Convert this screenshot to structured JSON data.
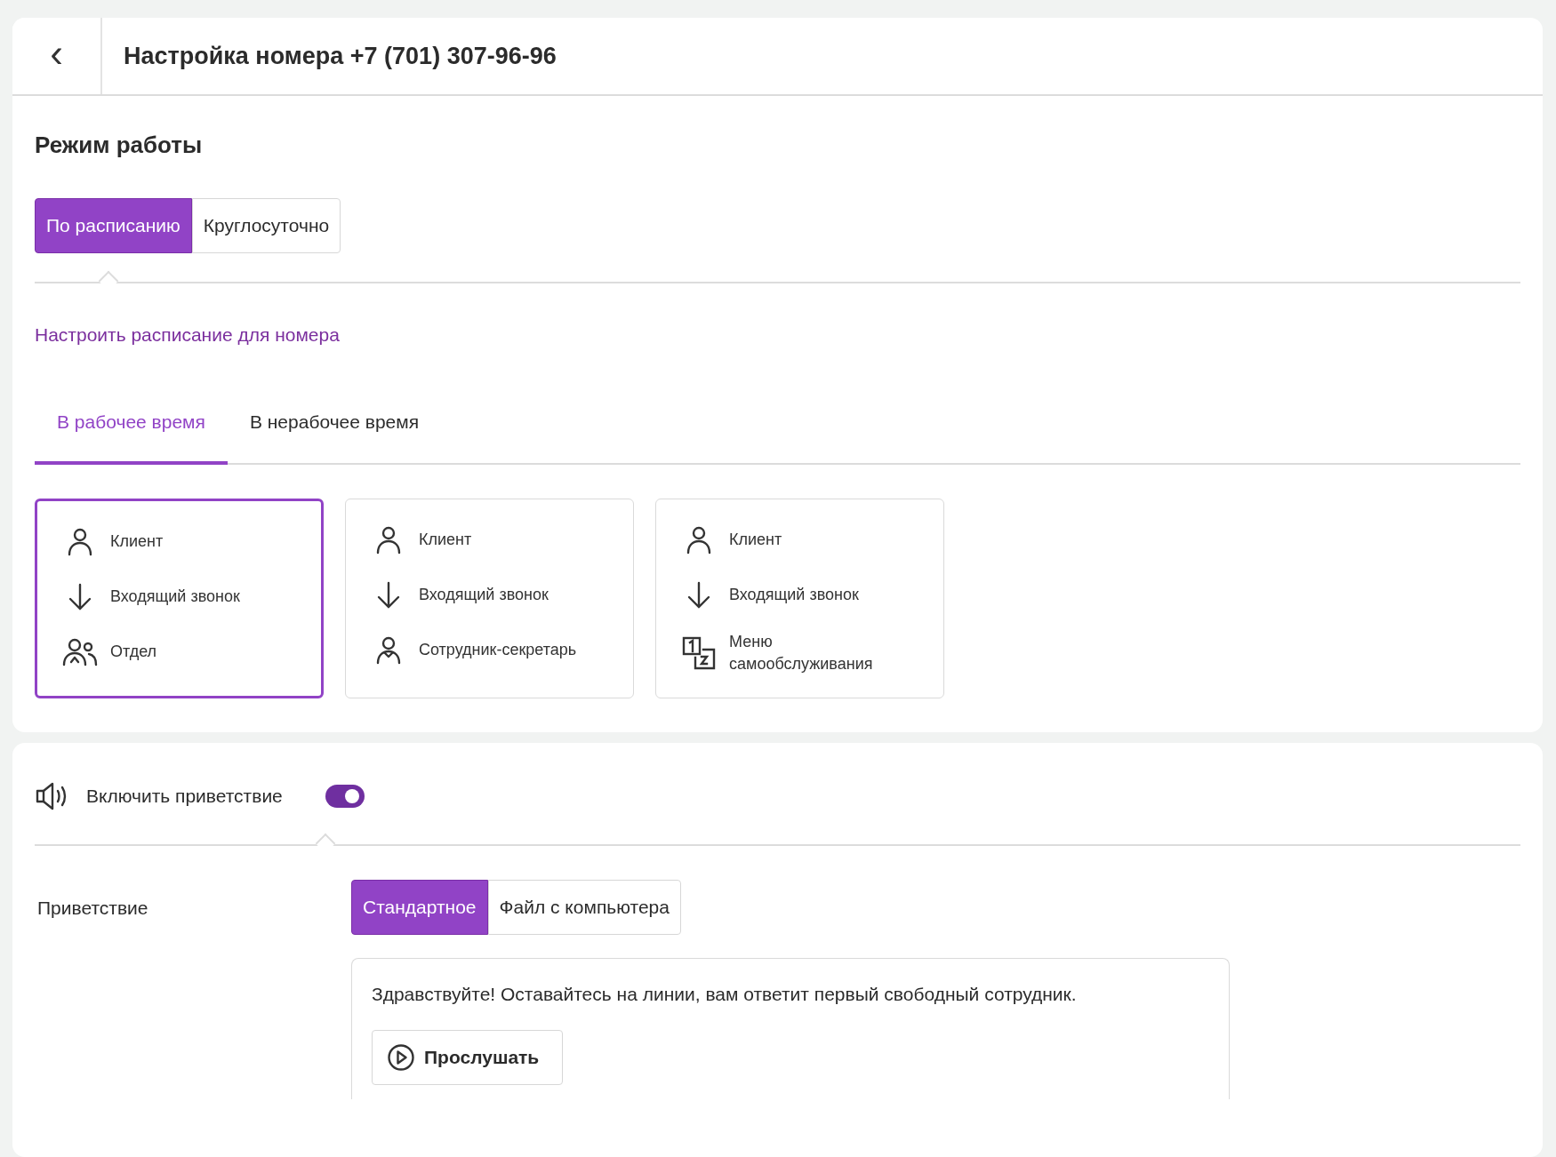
{
  "header": {
    "back_icon": "‹",
    "title": "Настройка номера +7 (701) 307-96-96"
  },
  "work_mode": {
    "title": "Режим работы",
    "options": [
      {
        "label": "По расписанию",
        "selected": true
      },
      {
        "label": "Круглосуточно",
        "selected": false
      }
    ],
    "schedule_link": "Настроить расписание для номера",
    "tabs": [
      {
        "label": "В рабочее время",
        "selected": true
      },
      {
        "label": "В нерабочее время",
        "selected": false
      }
    ],
    "scenarios": [
      {
        "selected": true,
        "steps": [
          {
            "kind": "client",
            "label": "Клиент"
          },
          {
            "kind": "incoming",
            "label": "Входящий звонок"
          },
          {
            "kind": "department",
            "label": "Отдел"
          }
        ]
      },
      {
        "selected": false,
        "steps": [
          {
            "kind": "client",
            "label": "Клиент"
          },
          {
            "kind": "incoming",
            "label": "Входящий звонок"
          },
          {
            "kind": "employee",
            "label": "Сотрудник-секретарь"
          }
        ]
      },
      {
        "selected": false,
        "steps": [
          {
            "kind": "client",
            "label": "Клиент"
          },
          {
            "kind": "incoming",
            "label": "Входящий звонок"
          },
          {
            "kind": "menu",
            "label": "Меню самообслуживания"
          }
        ]
      }
    ]
  },
  "greeting": {
    "toggle": {
      "label": "Включить приветствие",
      "on": true
    },
    "label": "Приветствие",
    "options": [
      {
        "label": "Стандартное",
        "selected": true
      },
      {
        "label": "Файл с компьютера",
        "selected": false
      }
    ],
    "message": "Здравствуйте! Оставайтесь на линии, вам ответит первый свободный сотрудник.",
    "listen_button": "Прослушать"
  }
}
